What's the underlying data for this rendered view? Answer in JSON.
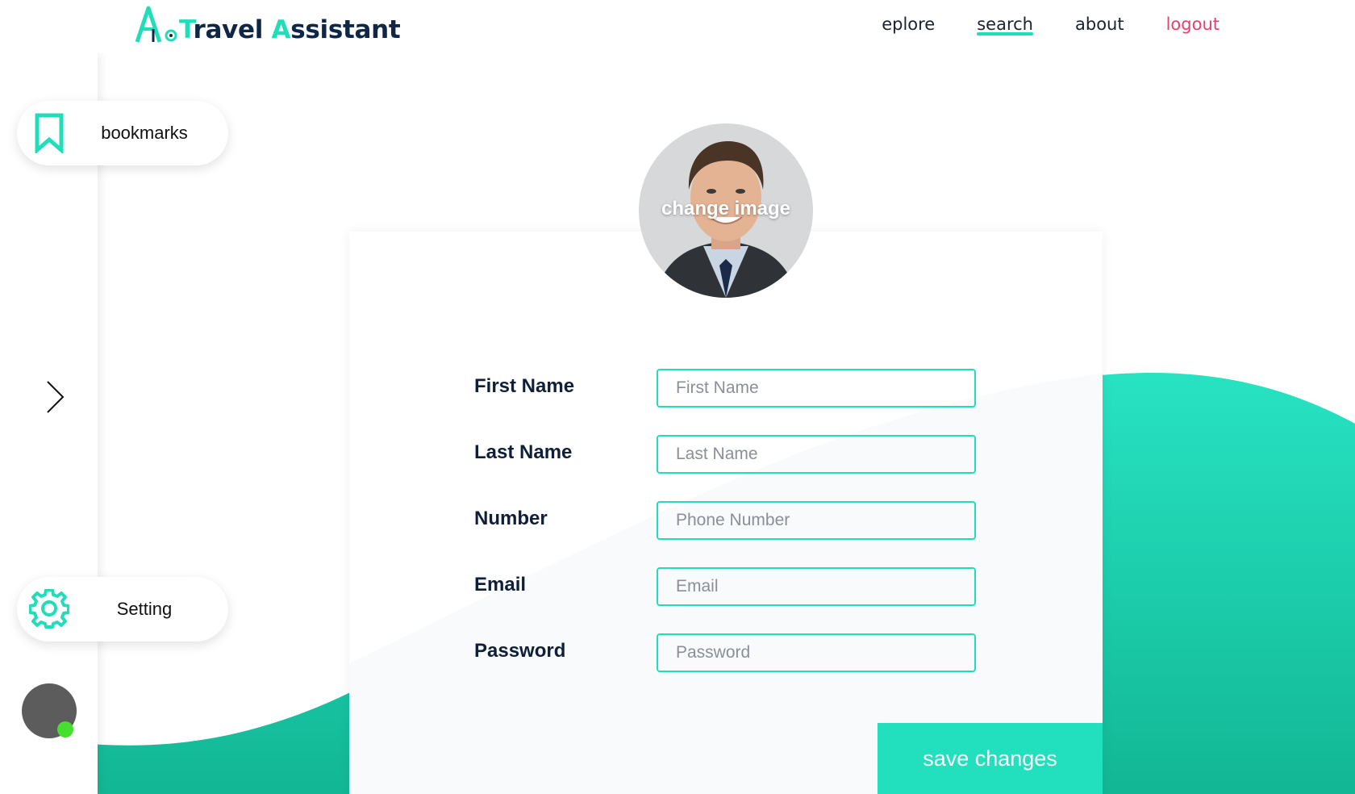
{
  "header": {
    "logo_letter": "A",
    "logo_word1_first": "T",
    "logo_word1_rest": "ravel ",
    "logo_word2_first": "A",
    "logo_word2_rest": "ssistant",
    "nav": {
      "explore": "eplore",
      "search": "search",
      "about": "about",
      "logout": "logout"
    }
  },
  "sidebar": {
    "bookmarks_label": "bookmarks",
    "setting_label": "Setting"
  },
  "profile": {
    "change_image_label": "change image"
  },
  "form": {
    "first_name": {
      "label": "First Name",
      "placeholder": "First Name"
    },
    "last_name": {
      "label": "Last Name",
      "placeholder": "Last Name"
    },
    "number": {
      "label": "Number",
      "placeholder": "Phone Number"
    },
    "email": {
      "label": "Email",
      "placeholder": "Email"
    },
    "password": {
      "label": "Password",
      "placeholder": "Password"
    },
    "save_label": "save changes"
  },
  "colors": {
    "accent": "#22ddb9",
    "logout": "#e8416b",
    "navy": "#0f2747",
    "online": "#45e02e"
  }
}
